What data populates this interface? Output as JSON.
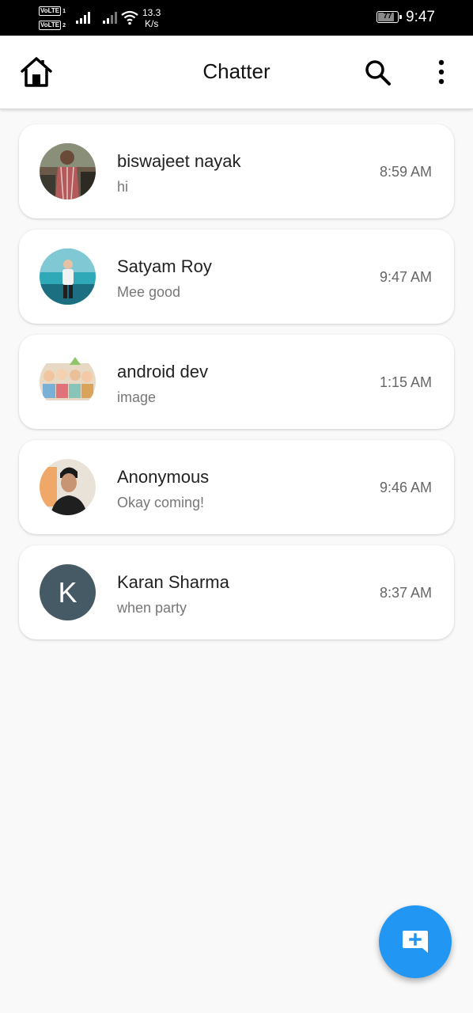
{
  "status_bar": {
    "volte1": "VoLTE",
    "volte1_sub": "1",
    "volte2": "VoLTE",
    "volte2_sub": "2",
    "net_speed_value": "13.3",
    "net_speed_unit": "K/s",
    "battery": "77",
    "battery_level": 0.77,
    "time": "9:47"
  },
  "app_bar": {
    "title": "Chatter",
    "home_icon": "home-icon",
    "search_icon": "search-icon",
    "more_icon": "more-vertical-icon"
  },
  "chats": [
    {
      "name": "biswajeet nayak",
      "message": "hi",
      "time": "8:59 AM",
      "avatar": "photo"
    },
    {
      "name": "Satyam Roy",
      "message": "Mee good",
      "time": "9:47 AM",
      "avatar": "photo"
    },
    {
      "name": "android dev",
      "message": "image",
      "time": "1:15 AM",
      "avatar": "photo"
    },
    {
      "name": "Anonymous",
      "message": "Okay coming!",
      "time": "9:46 AM",
      "avatar": "photo"
    },
    {
      "name": "Karan Sharma",
      "message": "when party",
      "time": "8:37 AM",
      "avatar": "letter",
      "initial": "K"
    }
  ],
  "fab": {
    "icon": "new-message-icon"
  },
  "colors": {
    "accent": "#2196f3",
    "letter_avatar_bg": "#455a64",
    "background": "#f9f9f9"
  }
}
